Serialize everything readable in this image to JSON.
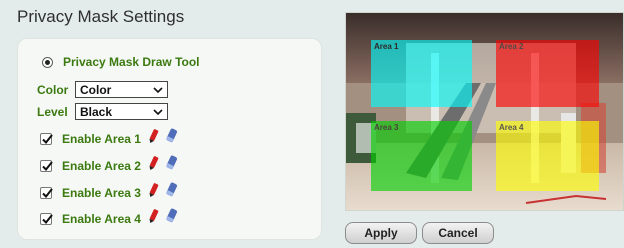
{
  "page_title": "Privacy Mask Settings",
  "draw_tool": {
    "label": "Privacy Mask Draw Tool",
    "selected": true
  },
  "color": {
    "label": "Color",
    "value": "Color"
  },
  "level": {
    "label": "Level",
    "value": "Black"
  },
  "areas": [
    {
      "label": "Enable Area 1",
      "checked": true
    },
    {
      "label": "Enable Area 2",
      "checked": true
    },
    {
      "label": "Enable Area 3",
      "checked": true
    },
    {
      "label": "Enable Area 4",
      "checked": true
    }
  ],
  "preview": {
    "area_labels": [
      "Area 1",
      "Area 2",
      "Area 3",
      "Area 4"
    ],
    "area_colors": [
      "#00ffff",
      "#ff0000",
      "#00d000",
      "#ffff00"
    ]
  },
  "buttons": {
    "apply": "Apply",
    "cancel": "Cancel"
  }
}
